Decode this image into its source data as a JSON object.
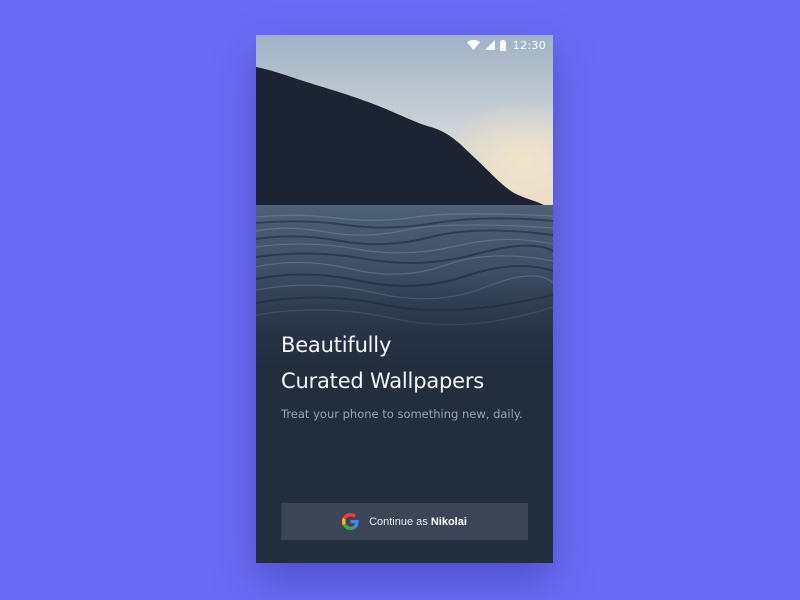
{
  "background_color": "#6b6cf6",
  "status_bar": {
    "time": "12:30",
    "icons": [
      "wifi-icon",
      "signal-icon",
      "battery-icon"
    ]
  },
  "onboarding": {
    "headline_line1": "Beautifully",
    "headline_line2": "Curated Wallpapers",
    "subtitle": "Treat your phone to something new, daily."
  },
  "google_button": {
    "prefix": "Continue as",
    "user_name": "Nikolai",
    "icon": "google-icon",
    "background": "#3b4556"
  },
  "colors": {
    "screen_background": "#222d3e",
    "headline": "#f4f6fa",
    "subtitle": "#9aa4b5"
  }
}
